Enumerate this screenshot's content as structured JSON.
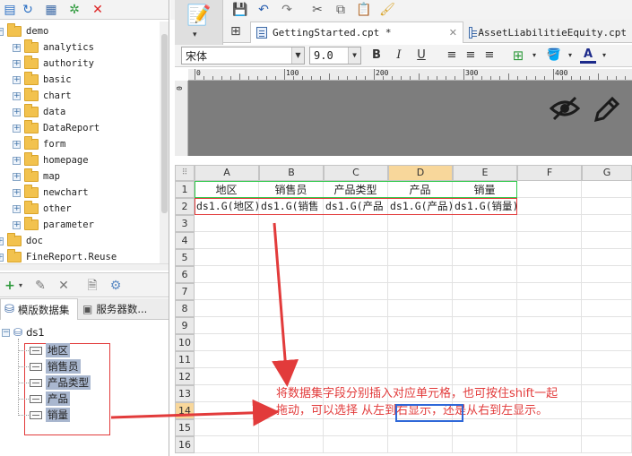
{
  "file_tree": {
    "root": "demo",
    "folders": [
      "analytics",
      "authority",
      "basic",
      "chart",
      "data",
      "DataReport",
      "form",
      "homepage",
      "map",
      "newchart",
      "other",
      "parameter"
    ],
    "siblings": [
      "doc",
      "FineReport.Reuse"
    ]
  },
  "dataset_panel": {
    "tabs": [
      "模版数据集",
      "服务器数..."
    ],
    "dataset": "ds1",
    "fields": [
      "地区",
      "销售员",
      "产品类型",
      "产品",
      "销量"
    ]
  },
  "editor": {
    "tabs": [
      "GettingStarted.cpt *",
      "AssetLiabilitieEquity.cpt"
    ],
    "font_name": "宋体",
    "font_size": "9.0",
    "ruler_marks": [
      "0",
      "100",
      "200",
      "300",
      "400"
    ]
  },
  "sheet": {
    "columns": [
      "A",
      "B",
      "C",
      "D",
      "E",
      "F",
      "G"
    ],
    "rows": [
      "1",
      "2",
      "3",
      "4",
      "5",
      "6",
      "7",
      "8",
      "9",
      "10",
      "11",
      "12",
      "13",
      "14",
      "15",
      "16"
    ],
    "selected_column": "D",
    "selected_row": "14",
    "header_cells": [
      "地区",
      "销售员",
      "产品类型",
      "产品",
      "销量"
    ],
    "field_cells": [
      "ds1.G(地区)",
      "ds1.G(销售",
      "ds1.G(产品",
      "ds1.G(产品)",
      "ds1.G(销量)"
    ]
  },
  "annotation": {
    "line1": "将数据集字段分别插入对应单元格，也可按住shift一起",
    "line2_before": "拖动，可以选择 从",
    "line2_boxed": "左到右显示",
    "line2_after": "，还是从右到左显示。"
  },
  "colors": {
    "annotation_red": "#e23b3b",
    "header_box_green": "#2ec94a",
    "selection_blue": "#2f68d8",
    "canvas_gray": "#7d7d7d",
    "selected_header": "#f8d79b"
  }
}
